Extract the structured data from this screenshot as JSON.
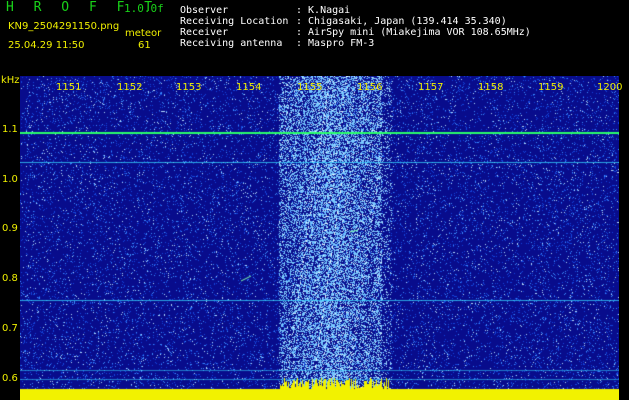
{
  "header": {
    "title": "H R O F F T",
    "version": "1.0.0f",
    "filename": "KN9_2504291150.png",
    "meteor_label": "meteor",
    "timestamp": "25.04.29 11:50",
    "count": "61",
    "fields": [
      {
        "label": "Observer",
        "value": ": K.Nagai"
      },
      {
        "label": "Receiving Location",
        "value": ": Chigasaki, Japan (139.414 35.340)"
      },
      {
        "label": "Receiver",
        "value": ": AirSpy mini (Miakejima VOR 108.65MHz)"
      },
      {
        "label": "Receiving antenna",
        "value": ": Maspro FM-3"
      }
    ]
  },
  "axes": {
    "x_unit_label": "kHz",
    "x_ticks": [
      "1151",
      "1152",
      "1153",
      "1154",
      "1155",
      "1156",
      "1157",
      "1158",
      "1159",
      "1200"
    ],
    "y_ticks": [
      "1.1",
      "1.0",
      "0.9",
      "0.8",
      "0.7",
      "0.6"
    ]
  },
  "colors": {
    "background": "#0b0b8a",
    "text_yellow": "#f0f000",
    "title_green": "#19d219",
    "line_green": "#2aff6a",
    "line_cyan": "#35d7ff"
  }
}
